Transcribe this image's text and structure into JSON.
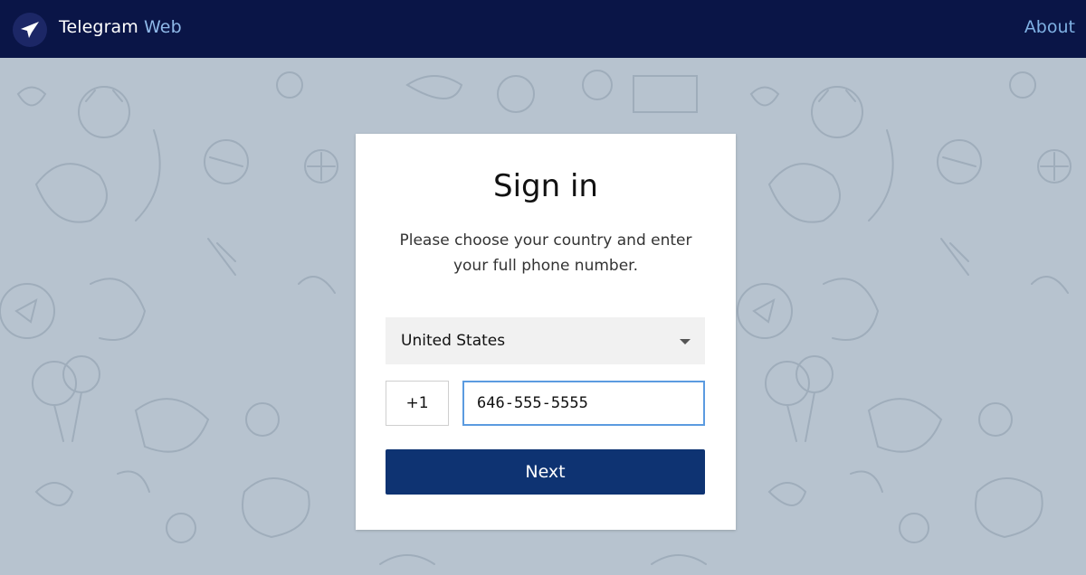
{
  "header": {
    "brand_primary": "Telegram",
    "brand_secondary": "Web",
    "about_label": "About",
    "logo_icon": "paper-plane-icon"
  },
  "colors": {
    "header_bg": "#0a1547",
    "page_bg": "#b7c3cf",
    "button_bg": "#0e3372",
    "input_focus": "#5b9be0",
    "link": "#7fb1e4"
  },
  "signin": {
    "title": "Sign in",
    "subtitle_line1": "Please choose your country and enter",
    "subtitle_line2": "your full phone number.",
    "country": "United States",
    "country_code": "+1",
    "phone_value": "646-555-5555",
    "next_label": "Next"
  }
}
